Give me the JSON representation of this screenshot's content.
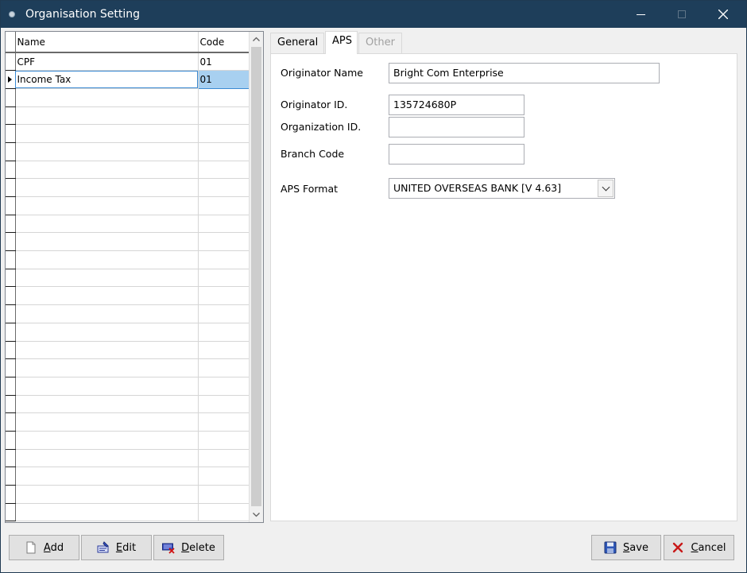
{
  "window": {
    "title": "Organisation Setting"
  },
  "grid": {
    "columns": {
      "name": "Name",
      "code": "Code"
    },
    "rows": [
      {
        "name": "CPF",
        "code": "01"
      },
      {
        "name": "Income Tax",
        "code": "01"
      }
    ],
    "selected_row": "Income Tax"
  },
  "tabs": {
    "general": "General",
    "aps": "APS",
    "other": "Other",
    "active": "APS"
  },
  "aps": {
    "originator_name_label": "Originator Name",
    "originator_name_value": "Bright Com Enterprise",
    "originator_id_label": "Originator ID.",
    "originator_id_value": "135724680P",
    "organization_id_label": "Organization ID.",
    "organization_id_value": "",
    "branch_code_label": "Branch Code",
    "branch_code_value": "",
    "aps_format_label": "APS Format",
    "aps_format_value": "UNITED OVERSEAS BANK [V 4.63]"
  },
  "buttons": {
    "add": {
      "mnemonic": "A",
      "rest": "dd"
    },
    "edit": {
      "mnemonic": "E",
      "rest": "dit"
    },
    "delete": {
      "mnemonic": "D",
      "rest": "elete"
    },
    "save": {
      "mnemonic": "S",
      "rest": "ave"
    },
    "cancel": {
      "mnemonic": "C",
      "rest": "ancel"
    }
  },
  "icons": {
    "title": "app-dot-icon",
    "minimize": "minimize-icon",
    "maximize": "maximize-icon",
    "close": "close-icon",
    "add": "new-document-icon",
    "edit": "edit-pencil-icon",
    "delete": "delete-keyboard-icon",
    "save": "floppy-disk-icon",
    "cancel": "red-x-icon"
  },
  "colors": {
    "titlebar": "#1e3e5a",
    "selection": "#a8d0f0",
    "selection_border": "#3a8ad3"
  }
}
